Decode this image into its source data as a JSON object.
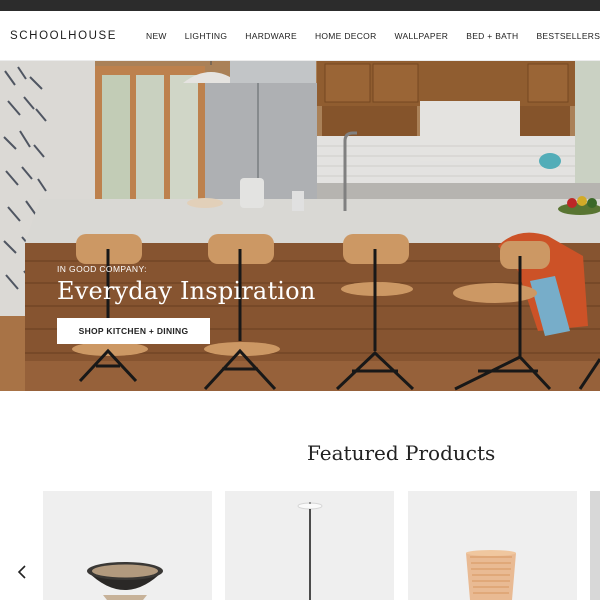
{
  "header": {
    "logo": "SCHOOLHOUSE",
    "nav": [
      "NEW",
      "LIGHTING",
      "HARDWARE",
      "HOME DECOR",
      "WALLPAPER",
      "BED + BATH",
      "BESTSELLERS"
    ]
  },
  "hero": {
    "eyebrow": "IN GOOD COMPANY:",
    "title": "Everyday Inspiration",
    "cta": "SHOP KITCHEN + DINING"
  },
  "featured": {
    "title": "Featured Products",
    "products": [
      {
        "kind": "ceramic-bowl"
      },
      {
        "kind": "floor-lamp"
      },
      {
        "kind": "amber-glass"
      }
    ]
  },
  "colors": {
    "accent_cta_bg": "#ffffff",
    "card_bg": "#efefef",
    "wood": "#9a6a42"
  }
}
